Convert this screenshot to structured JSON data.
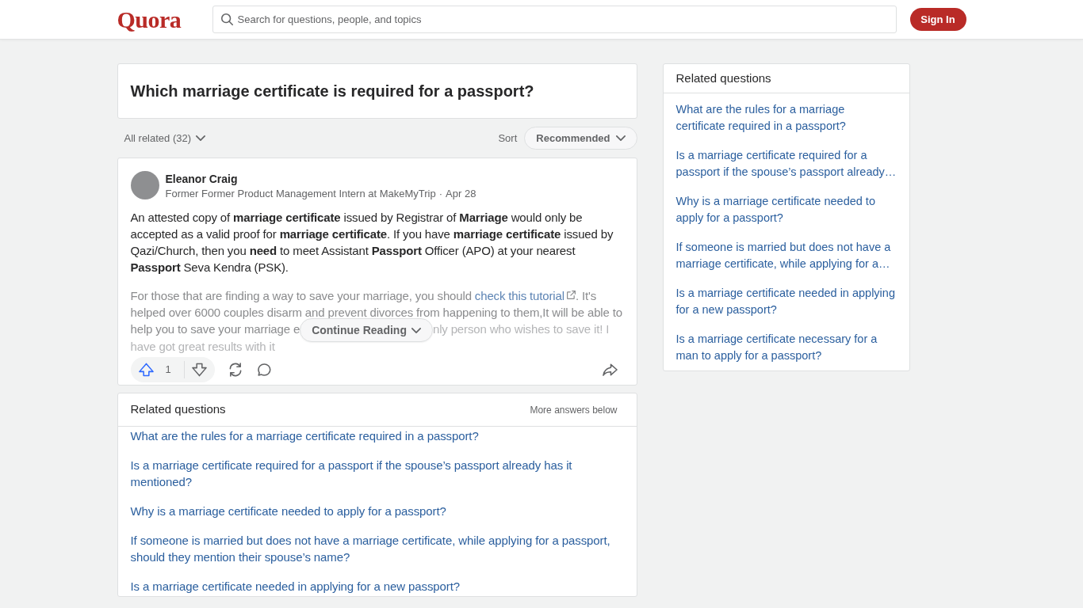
{
  "header": {
    "logo": "Quora",
    "search": {
      "placeholder": "Search for questions, people, and topics"
    },
    "sign_in_button": "Sign In"
  },
  "question": {
    "title": "Which marriage certificate is required for a passport?"
  },
  "filter_bar": {
    "all_related": "All related (32)",
    "sort_label": "Sort",
    "sort_value": "Recommended"
  },
  "answer": {
    "author": {
      "name": "Eleanor Craig",
      "credential": "Former Former Product Management Intern at MakeMyTrip",
      "separator": "·",
      "date": "Apr 28"
    },
    "paragraphs": [
      {
        "kind": "text",
        "text": "An attested copy of **marriage certificate** issued by Registrar of **Marriage** would only be accepted as a valid proof for **marriage certificate**. If you have **marriage certificate** issued by Qazi/Church, then you **need** to meet Assistant **Passport** Officer (APO) at your nearest **Passport** Seva Kendra (PSK)."
      },
      {
        "kind": "promo",
        "before_link": "For those that are finding a way to save your marriage, you should ",
        "link": "check this tutorial",
        "after_link": ". It's helped over 6000 couples disarm and prevent divorces from happening to them,It will be able to help you to save your marriage e",
        "after_button": "nly person who wishes to save it! I have got great results with it"
      }
    ],
    "continue_button": "Continue Reading",
    "upvote_count": "1"
  },
  "related_questions": {
    "title": "Related questions",
    "note": "More answers below",
    "questions": [
      "What are the rules for a marriage certificate required in a passport?",
      "Is a marriage certificate required for a passport if the spouse’s passport already has it mentioned?",
      "Why is a marriage certificate needed to apply for a passport?",
      "If someone is married but does not have a marriage certificate, while applying for a passport, should they mention their spouse’s name?",
      "Is a marriage certificate needed in applying for a new passport?"
    ]
  },
  "sidebar": {
    "related_questions": {
      "title": "Related questions",
      "questions": [
        "What are the rules for a marriage certificate required in a passport?",
        "Is a marriage certificate required for a passport if the spouse’s passport already…",
        "Why is a marriage certificate needed to apply for a passport?",
        "If someone is married but does not have a marriage certificate, while applying for a…",
        "Is a marriage certificate needed in applying for a new passport?",
        "Is a marriage certificate necessary for a man to apply for a passport?"
      ]
    }
  }
}
